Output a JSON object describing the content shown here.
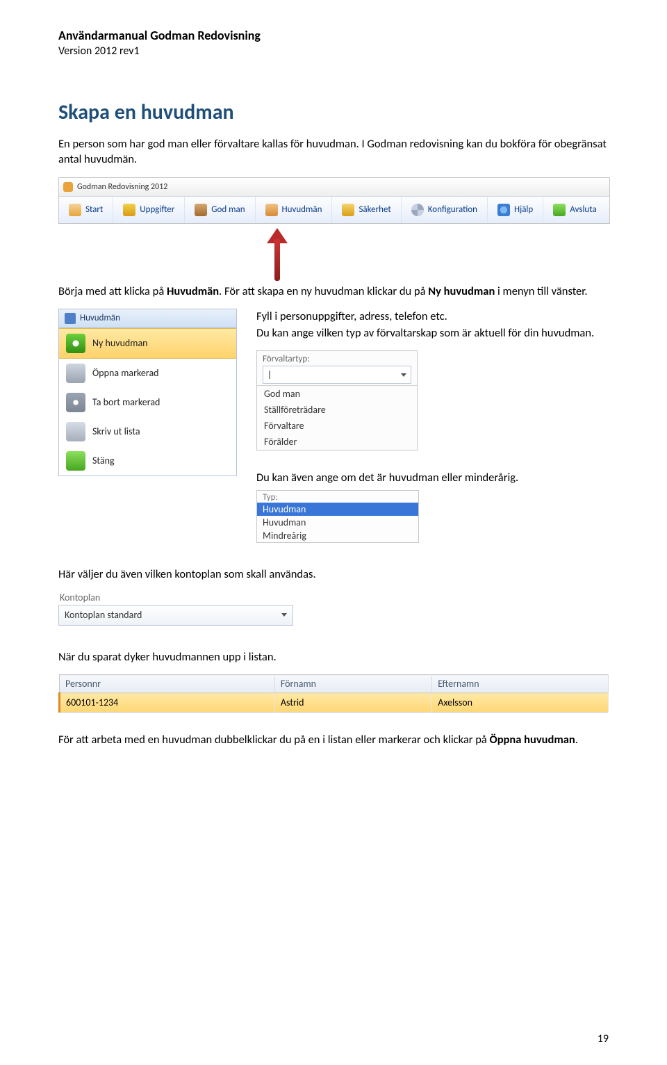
{
  "header": {
    "title": "Användarmanual Godman Redovisning",
    "sub": "Version 2012 rev1"
  },
  "section_title": "Skapa en huvudman",
  "para1": "En person som har god man eller förvaltare kallas för huvudman. I Godman redovisning kan du bokföra för obegränsat antal huvudmän.",
  "toolbar": {
    "win_title": "Godman Redovisning 2012",
    "items": [
      "Start",
      "Uppgifter",
      "God man",
      "Huvudmän",
      "Säkerhet",
      "Konfiguration",
      "Hjälp",
      "Avsluta"
    ]
  },
  "para2a": "Börja med att klicka på ",
  "para2b": "Huvudmän",
  "para2c": ". För att skapa en ny huvudman klickar du på ",
  "para2d": "Ny huvudman",
  "para2e": " i menyn till vänster.",
  "sidemenu": {
    "title": "Huvudmän",
    "items": [
      "Ny huvudman",
      "Öppna markerad",
      "Ta bort markerad",
      "Skriv ut lista",
      "Stäng"
    ]
  },
  "right": {
    "p1": "Fyll i personuppgifter, adress, telefon etc.",
    "p2": "Du kan ange vilken typ av förvaltarskap som är aktuell för din huvudman.",
    "dd_label": "Förvaltartyp:",
    "dd_options": [
      "God man",
      "Ställföreträdare",
      "Förvaltare",
      "Förälder"
    ],
    "p3": "Du kan även ange om det är huvudman eller minderårig.",
    "typ_label": "Typ:",
    "typ_selected": "Huvudman",
    "typ_options": [
      "Huvudman",
      "Mindreårig"
    ]
  },
  "para3": "Här väljer du även vilken kontoplan som skall användas.",
  "kontoplan": {
    "label": "Kontoplan",
    "value": "Kontoplan standard"
  },
  "para4": "När du sparat dyker huvudmannen upp i listan.",
  "table": {
    "headers": [
      "Personnr",
      "Förnamn",
      "Efternamn"
    ],
    "row": [
      "600101-1234",
      "Astrid",
      "Axelsson"
    ]
  },
  "para5a": "För att arbeta med en huvudman dubbelklickar du på en i listan eller markerar och klickar på ",
  "para5b": "Öppna huvudman",
  "para5c": ".",
  "page_number": "19"
}
